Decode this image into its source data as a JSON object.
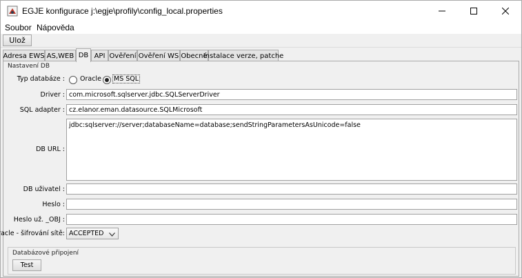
{
  "window": {
    "title": "EGJE konfigurace j:\\egje\\profily\\config_local.properties",
    "icons": {
      "app": "app-icon",
      "minimize": "minimize-icon",
      "maximize": "maximize-icon",
      "close": "close-icon"
    }
  },
  "menu": {
    "items": [
      "Soubor",
      "Nápověda"
    ]
  },
  "toolbar": {
    "save_label": "Ulož"
  },
  "tabs": [
    {
      "label": "Adresa EWS",
      "active": false
    },
    {
      "label": "AS,WEB",
      "active": false
    },
    {
      "label": "DB",
      "active": true
    },
    {
      "label": "API",
      "active": false
    },
    {
      "label": "Ověření",
      "active": false
    },
    {
      "label": "Ověření WS",
      "active": false
    },
    {
      "label": "Obecné",
      "active": false
    },
    {
      "label": "Instalace verze, patche",
      "active": false
    }
  ],
  "db": {
    "group_title": "Nastavení DB",
    "db_type_label": "Typ databáze :",
    "db_type_options": [
      "Oracle",
      "MS SQL"
    ],
    "db_type_selected": "MS SQL",
    "driver_label": "Driver :",
    "driver_value": "com.microsoft.sqlserver.jdbc.SQLServerDriver",
    "sql_adapter_label": "SQL adapter :",
    "sql_adapter_value": "cz.elanor.eman.datasource.SQLMicrosoft",
    "db_url_label": "DB URL :",
    "db_url_value": "jdbc:sqlserver://server;databaseName=database;sendStringParametersAsUnicode=false",
    "db_user_label": "DB uživatel :",
    "db_user_value": "",
    "password_label": "Heslo :",
    "password_value": "",
    "password_obj_label": "Heslo už. _OBJ :",
    "password_obj_value": "",
    "encryption_label": "Oracle - šifrování sítě:",
    "encryption_value": "ACCEPTED"
  },
  "connection": {
    "group_title": "Databázové připojení",
    "test_label": "Test"
  }
}
